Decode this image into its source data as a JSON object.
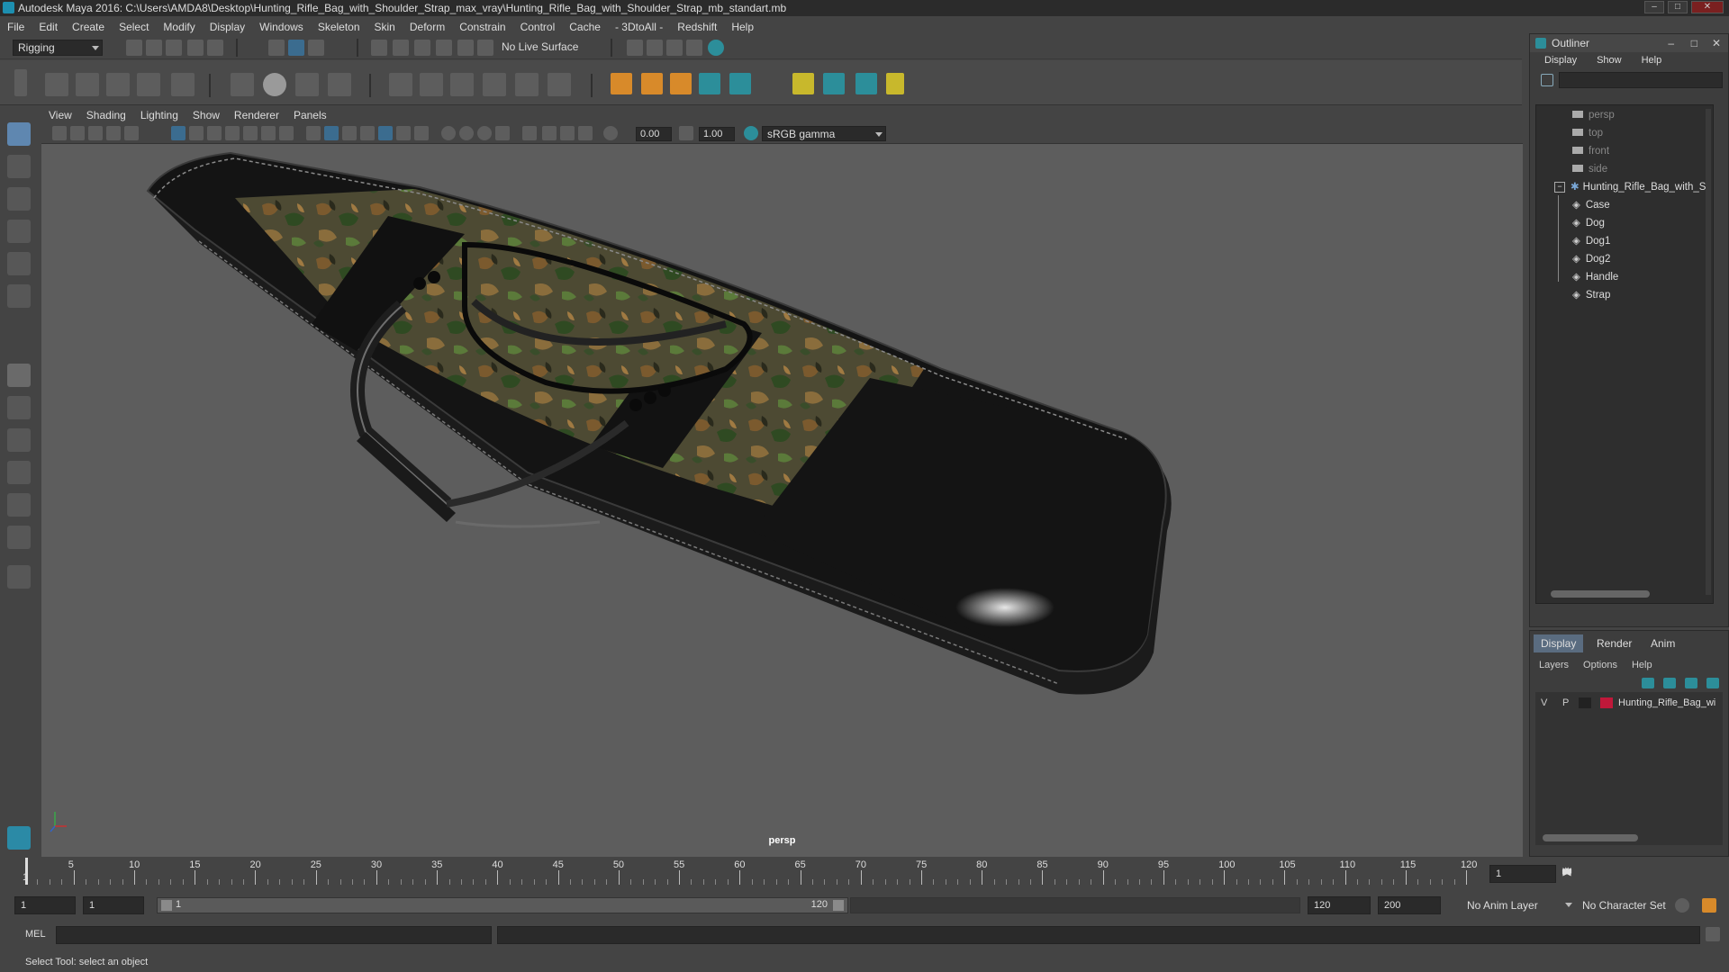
{
  "titlebar": {
    "title": "Autodesk Maya 2016: C:\\Users\\AMDA8\\Desktop\\Hunting_Rifle_Bag_with_Shoulder_Strap_max_vray\\Hunting_Rifle_Bag_with_Shoulder_Strap_mb_standart.mb"
  },
  "menubar": {
    "items": [
      "File",
      "Edit",
      "Create",
      "Select",
      "Modify",
      "Display",
      "Windows",
      "Skeleton",
      "Skin",
      "Deform",
      "Constrain",
      "Control",
      "Cache",
      "- 3DtoAll -",
      "Redshift",
      "Help"
    ]
  },
  "statusline": {
    "mode": "Rigging",
    "live_surface": "No Live Surface"
  },
  "viewport": {
    "menu": [
      "View",
      "Shading",
      "Lighting",
      "Show",
      "Renderer",
      "Panels"
    ],
    "near_value": "0.00",
    "far_value": "1.00",
    "color_space": "sRGB gamma",
    "camera_label": "persp"
  },
  "outliner": {
    "title": "Outliner",
    "menu": [
      "Display",
      "Show",
      "Help"
    ],
    "cameras": [
      "persp",
      "top",
      "front",
      "side"
    ],
    "group": "Hunting_Rifle_Bag_with_S",
    "children": [
      "Case",
      "Dog",
      "Dog1",
      "Dog2",
      "Handle",
      "Strap"
    ]
  },
  "channel": {
    "tabs": [
      "Display",
      "Render",
      "Anim"
    ],
    "menu": [
      "Layers",
      "Options",
      "Help"
    ],
    "layer": {
      "v": "V",
      "p": "P",
      "name": "Hunting_Rifle_Bag_wi",
      "color": "#c0183a"
    }
  },
  "timeline": {
    "ticks": [
      "5",
      "10",
      "15",
      "20",
      "25",
      "30",
      "35",
      "40",
      "45",
      "50",
      "55",
      "60",
      "65",
      "70",
      "75",
      "80",
      "85",
      "90",
      "95",
      "100",
      "105",
      "110",
      "115",
      "120"
    ],
    "start_label": "1",
    "current_frame": "1"
  },
  "range": {
    "start": "1",
    "anim_start": "1",
    "slider_start": "1",
    "slider_end": "120",
    "playback_end": "120",
    "anim_end": "200",
    "anim_layer": "No Anim Layer",
    "character_set": "No Character Set"
  },
  "cmdline": {
    "label": "MEL"
  },
  "helpline": {
    "text": "Select Tool: select an object"
  },
  "colors": {
    "maya_blue": "#1d8fb0",
    "active_tool": "#5f87b0"
  }
}
